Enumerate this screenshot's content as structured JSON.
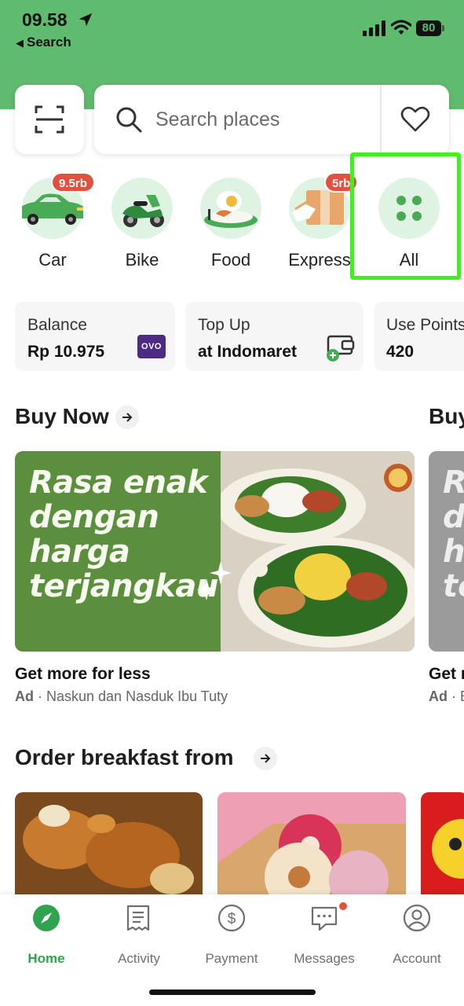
{
  "status_bar": {
    "time": "09.58",
    "back_label": "Search",
    "battery": "80"
  },
  "search": {
    "placeholder": "Search places"
  },
  "services": [
    {
      "label": "Car",
      "badge": "9.5rb"
    },
    {
      "label": "Bike"
    },
    {
      "label": "Food"
    },
    {
      "label": "Express",
      "badge": "5rb"
    },
    {
      "label": "All"
    }
  ],
  "wallet": [
    {
      "title": "Balance",
      "value": "Rp 10.975",
      "logo": "OVO"
    },
    {
      "title": "Top Up",
      "value": "at Indomaret"
    },
    {
      "title": "Use Points",
      "value": "420"
    }
  ],
  "buy_now": {
    "title": "Buy Now",
    "title_2": "Buy",
    "banner_text": "Rasa enak dengan harga terjangkau",
    "banner2_text": "Re da ha te",
    "promo_title": "Get more for less",
    "promo_title_2": "Get r",
    "ad_label": "Ad",
    "ad_merchant": "Naskun dan Nasduk Ibu Tuty",
    "ad_merchant_2": "B"
  },
  "breakfast": {
    "title": "Order breakfast from"
  },
  "bottom_nav": [
    {
      "label": "Home",
      "icon": "compass-icon",
      "active": true
    },
    {
      "label": "Activity",
      "icon": "receipt-icon"
    },
    {
      "label": "Payment",
      "icon": "dollar-icon"
    },
    {
      "label": "Messages",
      "icon": "chat-icon",
      "has_dot": true
    },
    {
      "label": "Account",
      "icon": "person-icon"
    }
  ],
  "colors": {
    "brand_green": "#5fbb6e",
    "nav_active": "#2fa34d",
    "badge_red": "#e2513d",
    "highlight": "#3ef01c"
  }
}
